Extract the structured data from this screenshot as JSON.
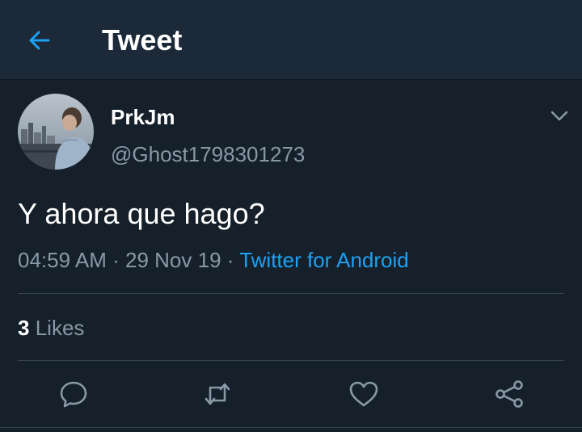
{
  "header": {
    "title": "Tweet",
    "back_icon": "arrow-left-icon",
    "accent_color": "#1da1f2"
  },
  "tweet": {
    "display_name": "PrkJm",
    "handle": "@Ghost1798301273",
    "text": "Y ahora que hago?",
    "time": "04:59 AM",
    "date": "29 Nov 19",
    "source": "Twitter for Android",
    "separator": "·",
    "likes_count": "3",
    "likes_label": "Likes",
    "more_icon": "chevron-down-icon"
  },
  "actions": {
    "reply_icon": "reply-icon",
    "retweet_icon": "retweet-icon",
    "like_icon": "heart-icon",
    "share_icon": "share-icon"
  },
  "colors": {
    "background": "#15202b",
    "header_background": "#1c2938",
    "secondary_text": "#8899a6",
    "divider": "#38444d"
  }
}
